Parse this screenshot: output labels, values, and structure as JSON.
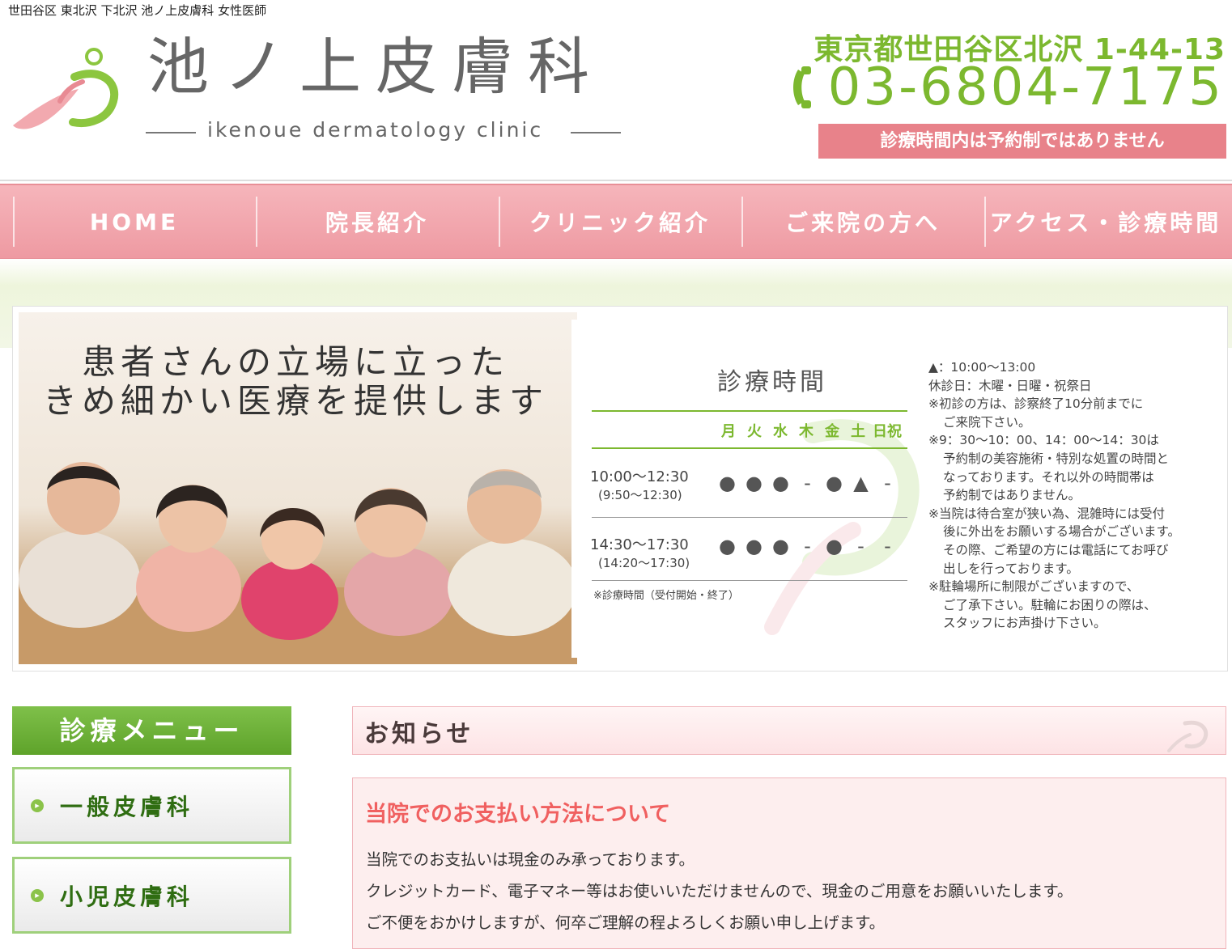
{
  "header": {
    "tagline": "世田谷区 東北沢 下北沢 池ノ上皮膚科 女性医師",
    "clinic_name": "池ノ上皮膚科",
    "clinic_name_en": "ikenoue dermatology clinic",
    "address": "東京都世田谷区北沢 1-44-13",
    "phone": "03-6804-7175",
    "notice": "診療時間内は予約制ではありません"
  },
  "nav": {
    "items": [
      "HOME",
      "院長紹介",
      "クリニック紹介",
      "ご来院の方へ",
      "アクセス・診療時間"
    ]
  },
  "hero": {
    "catch_line1": "患者さんの立場に立った",
    "catch_line2": "きめ細かい医療を提供します",
    "hours_title": "診療時間",
    "days": [
      "月",
      "火",
      "水",
      "木",
      "金",
      "土",
      "日祝"
    ],
    "slots": [
      {
        "time": "10:00～12:30",
        "reception": "(9:50～12:30)",
        "marks": [
          "●",
          "●",
          "●",
          "-",
          "●",
          "▲",
          "-"
        ]
      },
      {
        "time": "14:30～17:30",
        "reception": "(14:20～17:30)",
        "marks": [
          "●",
          "●",
          "●",
          "-",
          "●",
          "-",
          "-"
        ]
      }
    ],
    "hours_note": "※診療時間（受付開始・終了）",
    "notes": [
      "▲：10:00～13:00",
      "休診日：木曜・日曜・祝祭日",
      "※初診の方は、診察終了10分前までに",
      "ご来院下さい。",
      "※9：30～10：00、14：00～14：30は",
      "予約制の美容施術・特別な処置の時間と",
      "なっております。それ以外の時間帯は",
      "予約制ではありません。",
      "※当院は待合室が狭い為、混雑時には受付",
      "後に外出をお願いする場合がございます。",
      "その際、ご希望の方には電話にてお呼び",
      "出しを行っております。",
      "※駐輪場所に制限がございますので、",
      "ご了承下さい。駐輪にお困りの際は、",
      "スタッフにお声掛け下さい。"
    ]
  },
  "sidebar": {
    "title": "診療メニュー",
    "items": [
      "一般皮膚科",
      "小児皮膚科"
    ]
  },
  "news": {
    "title": "お知らせ",
    "headline": "当院でのお支払い方法について",
    "lines": [
      "当院でのお支払いは現金のみ承っております。",
      "クレジットカード、電子マネー等はお使いいただけませんので、現金のご用意をお願いいたします。",
      "ご不便をおかけしますが、何卒ご理解の程よろしくお願い申し上げます。"
    ]
  },
  "colors": {
    "brand_green": "#7cb82f",
    "brand_pink": "#e8828a",
    "nav_pink": "#f0a3aa",
    "news_red": "#f06060"
  }
}
